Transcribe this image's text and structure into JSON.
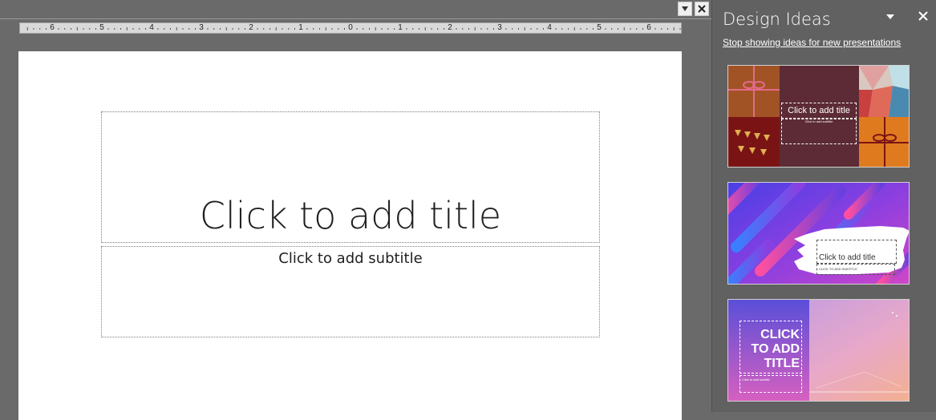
{
  "window_controls": {
    "dropdown_icon": "chevron-down-icon",
    "close_icon": "close-icon"
  },
  "ruler": {
    "labels": [
      "6",
      "5",
      "4",
      "3",
      "2",
      "1",
      "0",
      "1",
      "2",
      "3",
      "4",
      "5",
      "6"
    ]
  },
  "slide": {
    "title_placeholder": "Click to add title",
    "subtitle_placeholder": "Click to add subtitle"
  },
  "design_ideas": {
    "pane_title": "Design Ideas",
    "stop_link": "Stop showing ideas for new presentations",
    "ideas": [
      {
        "title": "Click to add title",
        "subtitle": "Click to add subtitle",
        "theme": "gift-party",
        "colors": {
          "maroon": "#5c2b35",
          "orange": "#e07a1e",
          "darkred": "#7a1414",
          "brown": "#a15326"
        }
      },
      {
        "title": "Click to add title",
        "subtitle": "CLICK TO ADD SUBTITLE",
        "theme": "purple-gradient-stripes",
        "colors": {
          "primary": "#6a3fe0",
          "accent": "#e83a9c"
        }
      },
      {
        "title": "CLICK TO ADD TITLE",
        "subtitle": "Click to add subtitle",
        "theme": "pastel-gradient",
        "colors": {
          "left": "#5a4fd8",
          "right": "#f0a6a0"
        }
      }
    ]
  },
  "colors": {
    "editor_background": "#6a6a6a",
    "pane_background": "#616161",
    "slide_background": "#ffffff"
  }
}
